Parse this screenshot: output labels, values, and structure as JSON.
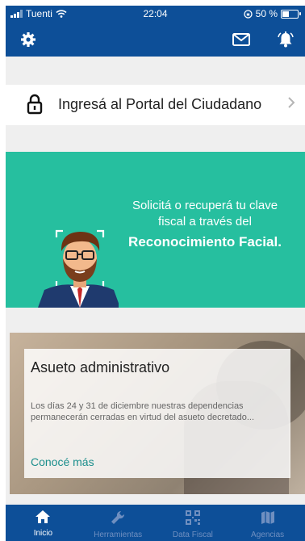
{
  "status_bar": {
    "carrier": "Tuenti",
    "time": "22:04",
    "battery": "50 %",
    "battery_level": 0.5
  },
  "header": {
    "settings_icon": "gear-icon",
    "mail_icon": "mail-icon",
    "notifications_icon": "bell-icon"
  },
  "portal": {
    "label": "Ingresá al Portal del Ciudadano",
    "icon": "lock-icon"
  },
  "banner": {
    "line1": "Solicitá o recuperá tu clave fiscal a través del",
    "line2": "Reconocimiento Facial."
  },
  "news": {
    "title": "Asueto administrativo",
    "body": "Los días 24 y 31 de diciembre nuestras dependencias permanecerán cerradas en virtud del asueto decretado...",
    "link": "Conocé más"
  },
  "tabs": [
    {
      "label": "Inicio",
      "icon": "home-icon",
      "active": true
    },
    {
      "label": "Herramientas",
      "icon": "wrench-icon",
      "active": false
    },
    {
      "label": "Data Fiscal",
      "icon": "qr-code-icon",
      "active": false
    },
    {
      "label": "Agencias",
      "icon": "map-icon",
      "active": false
    }
  ],
  "colors": {
    "primary": "#0d4f98",
    "banner": "#26bf9f",
    "link": "#1b8e8c"
  }
}
